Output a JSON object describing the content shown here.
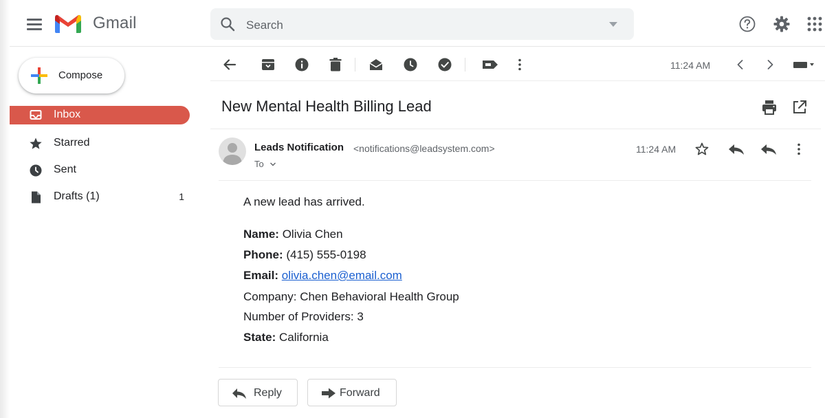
{
  "app": {
    "brand": "Gmail"
  },
  "search": {
    "placeholder": "Search"
  },
  "sidebar": {
    "compose_label": "Compose",
    "items": [
      {
        "label": "Inbox",
        "icon": "inbox-icon",
        "count": ""
      },
      {
        "label": "Starred",
        "icon": "star-icon",
        "count": ""
      },
      {
        "label": "Sent",
        "icon": "sent-icon",
        "count": ""
      },
      {
        "label": "Drafts (1)",
        "icon": "draft-icon",
        "count": "1"
      }
    ]
  },
  "toolbar": {
    "time": "11:24 AM"
  },
  "message": {
    "subject": "New Mental Health Billing Lead",
    "sender_name": "Leads Notification",
    "sender_email": "<notifications@leadsystem.com>",
    "to_label": "To",
    "time": "11:24 AM",
    "intro": "A new lead has arrived.",
    "fields": {
      "name_label": "Name:",
      "name_value": "Olivia Chen",
      "phone_label": "Phone:",
      "phone_value": "(415) 555-0198",
      "email_label": "Email:",
      "email_value": "olivia.chen@email.com",
      "company": "Company: Chen Behavioral Health Group",
      "providers": "Number of Providers: 3",
      "state_label": "State:",
      "state_value": "California"
    }
  },
  "actions": {
    "reply_label": "Reply",
    "forward_label": "Forward"
  },
  "colors": {
    "inbox_active": "#d9584b",
    "link": "#1a5fd0"
  }
}
